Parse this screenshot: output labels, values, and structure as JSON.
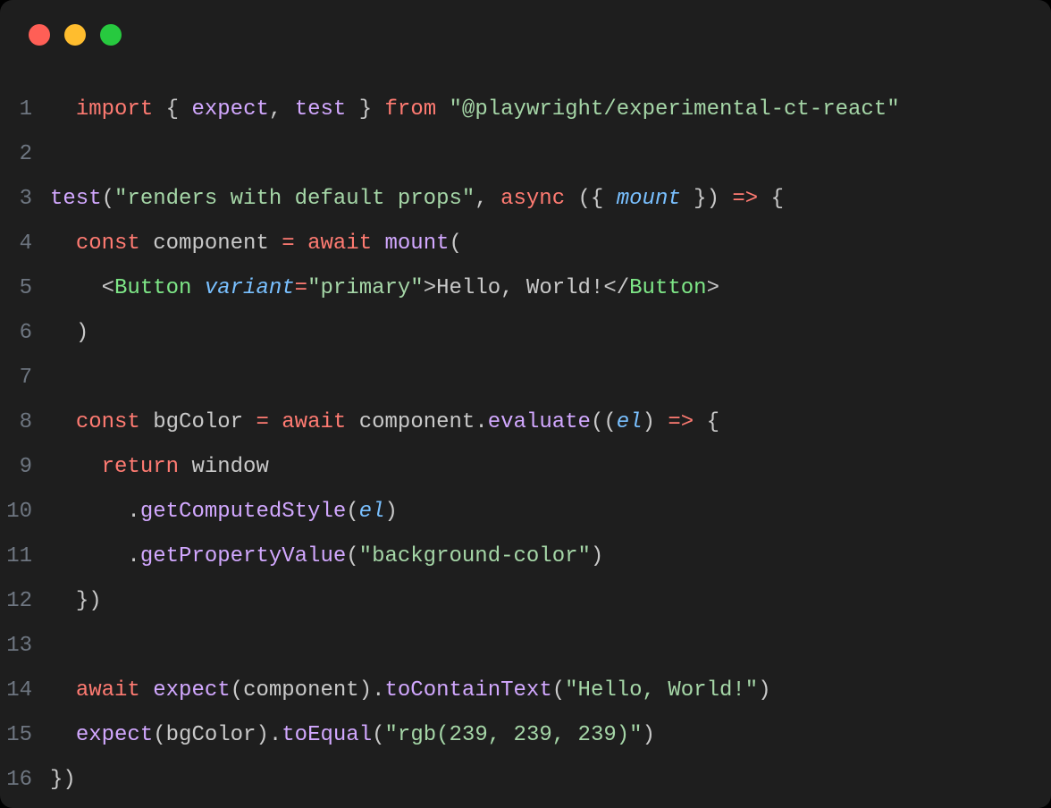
{
  "window": {
    "traffic_lights": [
      "close",
      "minimize",
      "maximize"
    ]
  },
  "code": {
    "line_numbers": [
      "1",
      "2",
      "3",
      "4",
      "5",
      "6",
      "7",
      "8",
      "9",
      "10",
      "11",
      "12",
      "13",
      "14",
      "15",
      "16"
    ],
    "t": {
      "import": "import",
      "from": "from",
      "expect": "expect",
      "test": "test",
      "lbrace": "{",
      "rbrace": "}",
      "lparen": "(",
      "rparen": ")",
      "comma": ",",
      "dot": ".",
      "arrow": "=>",
      "eq": "=",
      "lt": "<",
      "gt": ">",
      "slash": "/",
      "sp": " ",
      "sp2": "  ",
      "sp4": "    ",
      "sp6": "      ",
      "pkg": "\"@playwright/experimental-ct-react\"",
      "test_name": "\"renders with default props\"",
      "async": "async",
      "mount": "mount",
      "const": "const",
      "component": "component",
      "await": "await",
      "Button": "Button",
      "variant": "variant",
      "primary": "\"primary\"",
      "hello": "Hello, World!",
      "bgColor": "bgColor",
      "evaluate": "evaluate",
      "el": "el",
      "return": "return",
      "window": "window",
      "getComputedStyle": "getComputedStyle",
      "getPropertyValue": "getPropertyValue",
      "bgcolor_str": "\"background-color\"",
      "toContainText": "toContainText",
      "hello_str": "\"Hello, World!\"",
      "toEqual": "toEqual",
      "rgb_str": "\"rgb(239, 239, 239)\""
    }
  }
}
